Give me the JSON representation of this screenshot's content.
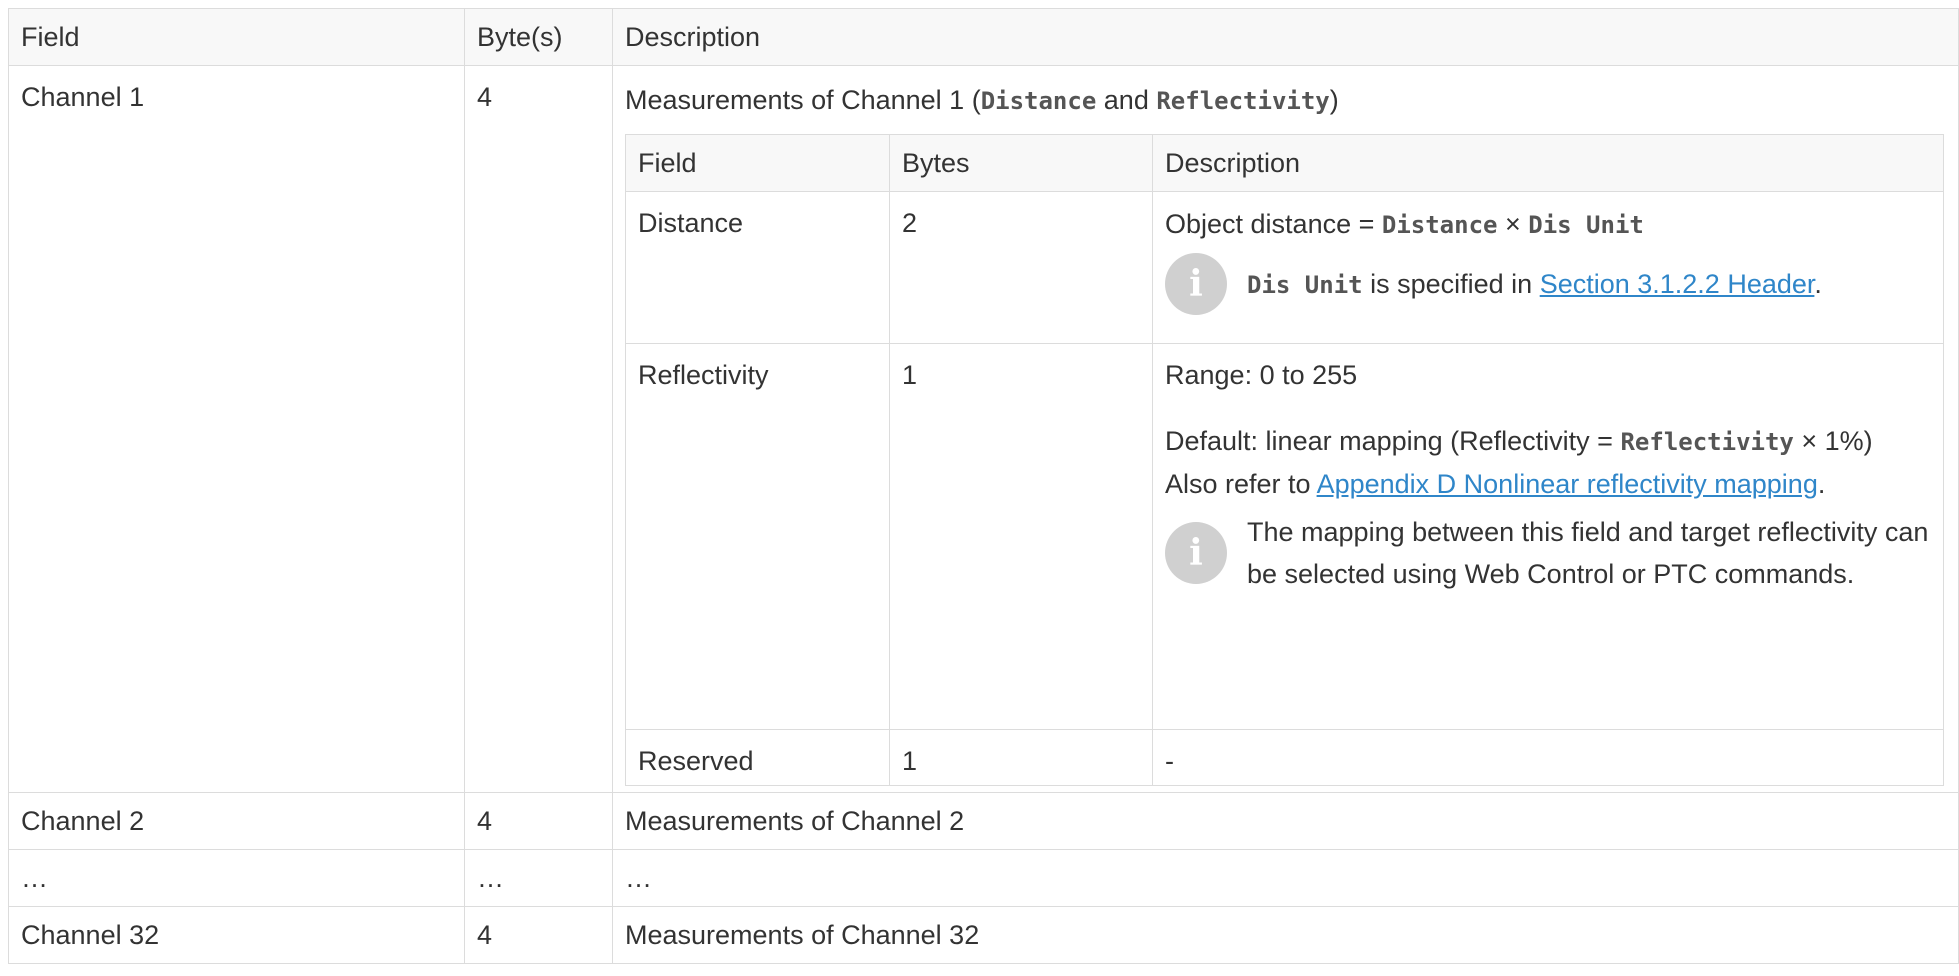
{
  "header": {
    "field": "Field",
    "bytes": "Byte(s)",
    "description": "Description"
  },
  "channel1": {
    "field": "Channel 1",
    "bytes": "4",
    "desc_prefix": "Measurements of Channel 1 (",
    "desc_code1": "Distance",
    "desc_and": " and ",
    "desc_code2": "Reflectivity",
    "desc_suffix": ")"
  },
  "inner": {
    "header": {
      "field": "Field",
      "bytes": "Bytes",
      "description": "Description"
    },
    "distance": {
      "field": "Distance",
      "bytes": "2",
      "formula_prefix": "Object distance = ",
      "formula_code1": "Distance",
      "formula_times": " × ",
      "formula_code2": "Dis Unit",
      "note_code": "Dis Unit",
      "note_text": " is specified in ",
      "note_link": "Section 3.1.2.2 Header",
      "note_end": "."
    },
    "reflectivity": {
      "field": "Reflectivity",
      "bytes": "1",
      "range": "Range: 0 to 255",
      "default_prefix": "Default: linear mapping (Reflectivity = ",
      "default_code": "Reflectivity",
      "default_suffix": " × 1%)",
      "refer_prefix": "Also refer to ",
      "refer_link": "Appendix D Nonlinear reflectivity mapping",
      "refer_end": ".",
      "note": "The mapping between this field and target reflectivity can be selected using Web Control or PTC commands."
    },
    "reserved": {
      "field": "Reserved",
      "bytes": "1",
      "description": "-"
    }
  },
  "rows": [
    {
      "field": "Channel 2",
      "bytes": "4",
      "description": "Measurements of Channel 2"
    },
    {
      "field": "…",
      "bytes": "…",
      "description": "…"
    },
    {
      "field": "Channel 32",
      "bytes": "4",
      "description": "Measurements of Channel 32"
    }
  ],
  "icons": {
    "note": "info-icon"
  },
  "colors": {
    "link": "#2f86c9",
    "header_bg": "#f8f8f8",
    "icon_bg": "#d0d0d0"
  }
}
